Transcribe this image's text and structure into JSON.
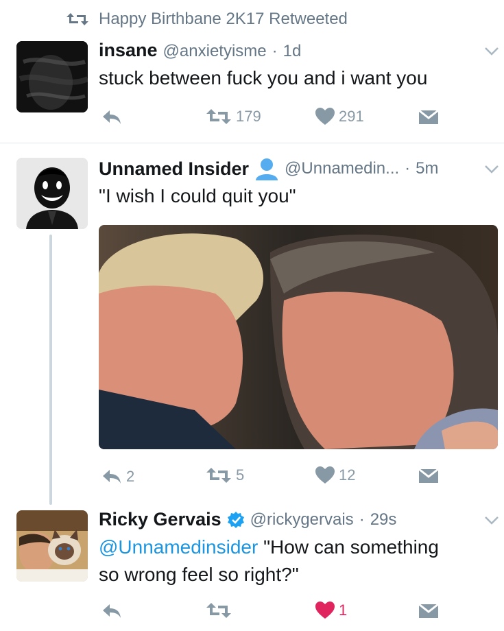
{
  "retweet_banner": {
    "text": "Happy Birthbane 2K17 Retweeted"
  },
  "tweets": [
    {
      "name": "insane",
      "handle": "@anxietyisme",
      "sep": "·",
      "time": "1d",
      "text": "stuck between fuck you and i want you",
      "reply_count": "",
      "retweet_count": "179",
      "like_count": "291"
    },
    {
      "name": "Unnamed Insider",
      "handle": "@Unnamedin...",
      "sep": "·",
      "time": "5m",
      "text": "\"I wish I could quit you\"",
      "reply_count": "2",
      "retweet_count": "5",
      "like_count": "12"
    },
    {
      "name": "Ricky Gervais",
      "handle": "@rickygervais",
      "sep": "·",
      "time": "29s",
      "mention": "@Unnamedinsider",
      "text_line1": " \"How can something",
      "text_line2": "so wrong feel so right?\"",
      "reply_count": "",
      "retweet_count": "",
      "like_count": "1"
    }
  ],
  "colors": {
    "icon": "#8899a6",
    "liked": "#e0245e",
    "verified": "#1da1f2",
    "mention": "#1b95e0",
    "thread": "#ccd6dd"
  },
  "icons": {
    "retweet": "retweet-icon",
    "reply": "reply-icon",
    "like": "heart-icon",
    "dm": "envelope-icon",
    "chevron": "chevron-down-icon",
    "verified": "verified-badge-icon",
    "translator": "person-badge-icon"
  }
}
